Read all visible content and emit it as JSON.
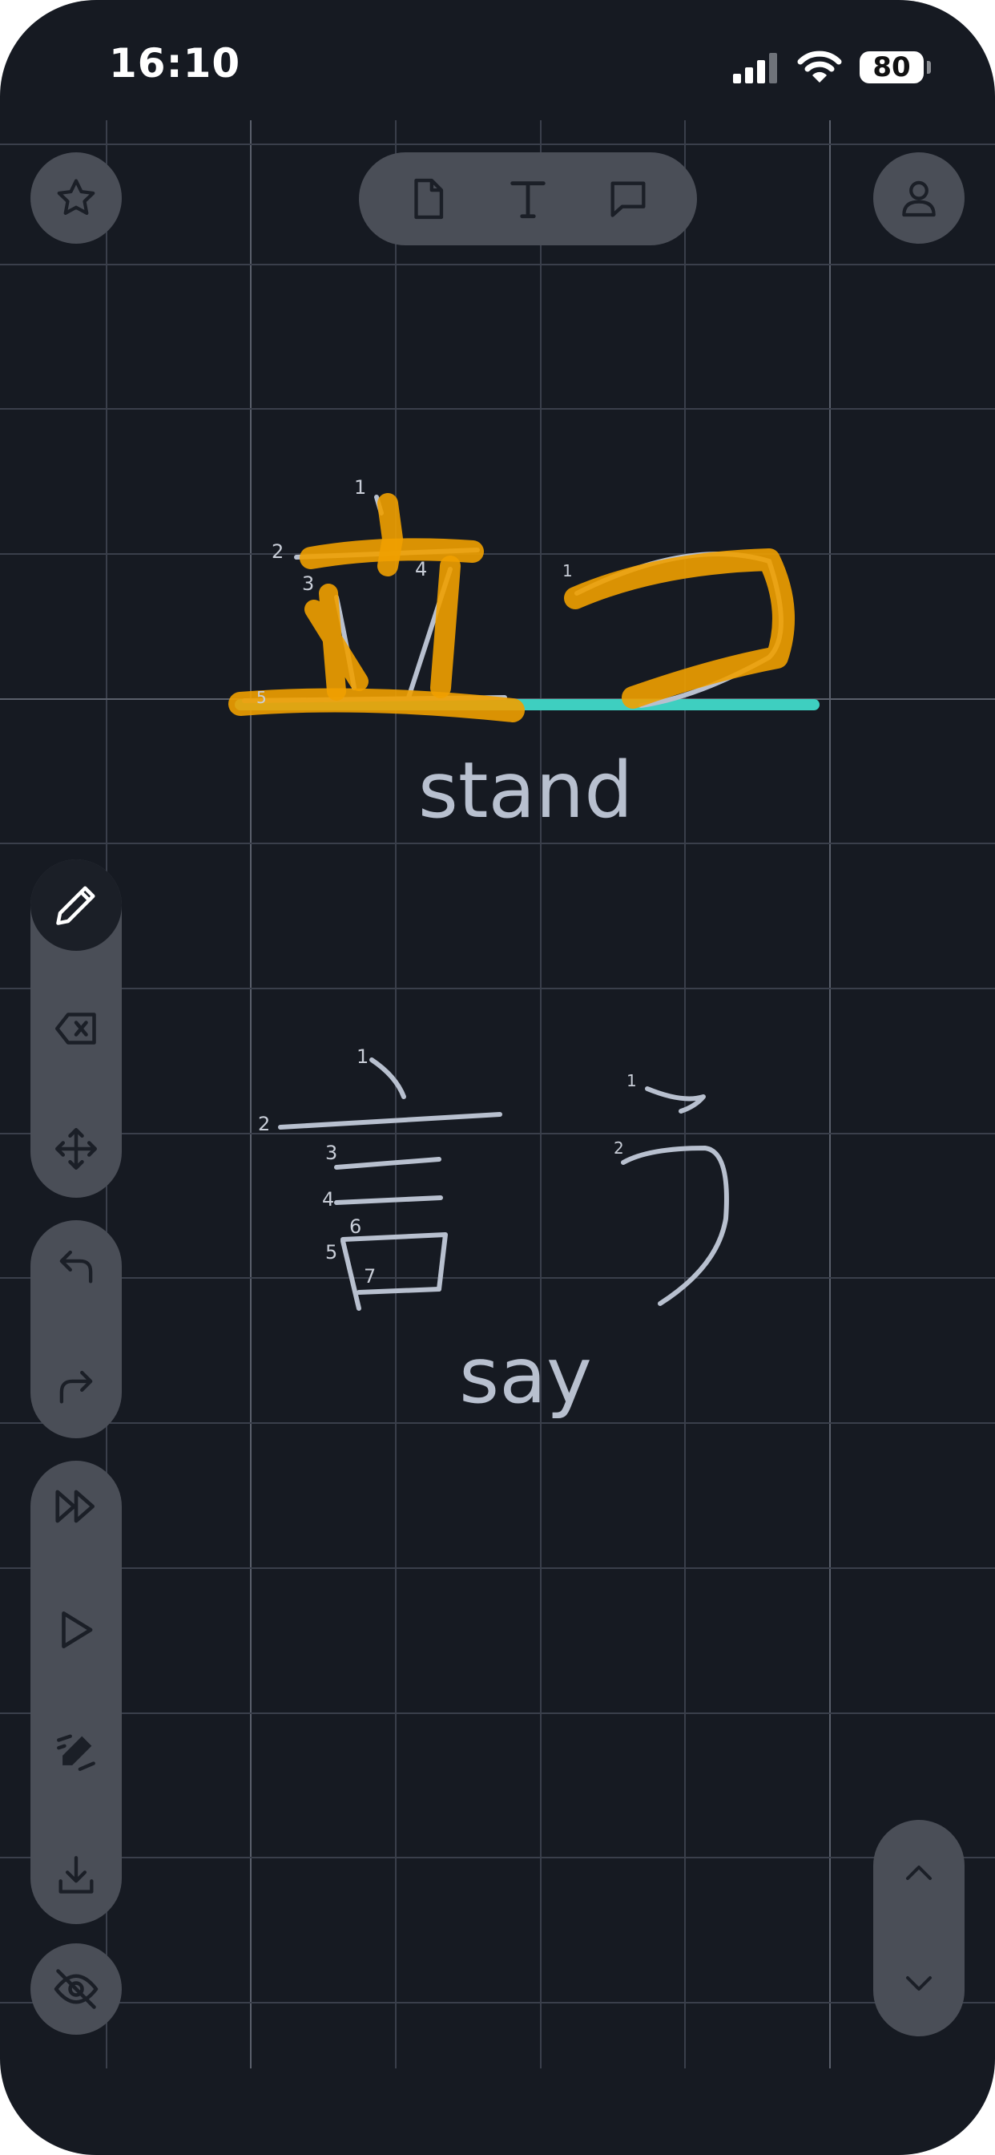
{
  "status_bar": {
    "time": "16:10",
    "battery_level": "80"
  },
  "toolbar_top": {
    "left_icon": "star-icon",
    "center_icons": [
      "document-icon",
      "text-icon",
      "speech-bubble-icon"
    ],
    "right_icon": "user-icon"
  },
  "canvas": {
    "words": [
      {
        "kanji": "立",
        "kana": "つ",
        "meaning": "stand",
        "stroke_numbers_kanji": [
          "1",
          "2",
          "3",
          "4",
          "5"
        ],
        "stroke_numbers_kana": [
          "1"
        ]
      },
      {
        "kanji": "言",
        "kana": "う",
        "meaning": "say",
        "stroke_numbers_kanji": [
          "1",
          "2",
          "3",
          "4",
          "5",
          "6",
          "7"
        ],
        "stroke_numbers_kana": [
          "1",
          "2"
        ]
      }
    ]
  },
  "toolbar_left": {
    "draw_tools": [
      "pencil-icon",
      "eraser-icon",
      "move-icon"
    ],
    "history": [
      "undo-icon",
      "redo-icon"
    ],
    "playback": [
      "fast-forward-icon",
      "play-icon",
      "auto-draw-icon",
      "download-icon"
    ],
    "visibility": "eye-off-icon"
  },
  "toolbar_right": {
    "icons": [
      "chevron-up-icon",
      "chevron-down-icon"
    ]
  },
  "colors": {
    "background": "#161a22",
    "grid": "#3a3f4b",
    "stroke": "#b8c0cf",
    "trace": "#f0a000",
    "baseline": "#3ecfc0",
    "button": "#4a4e57"
  }
}
